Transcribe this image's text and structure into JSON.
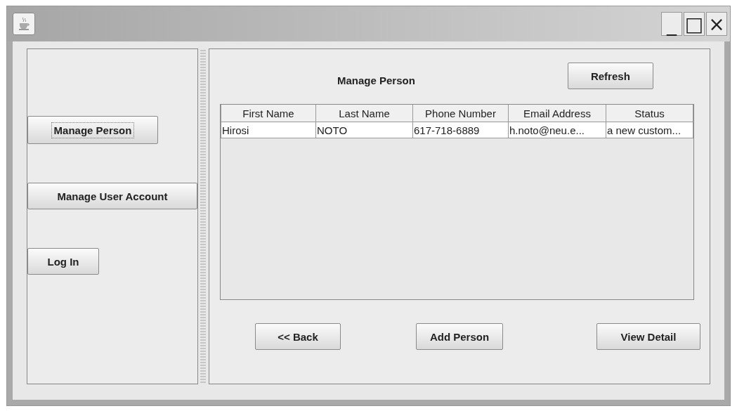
{
  "window": {
    "controls": [
      "_",
      "□",
      "×"
    ]
  },
  "sidebar": {
    "buttons": [
      {
        "label": "Manage Person",
        "focused": true
      },
      {
        "label": "Manage User Account",
        "focused": false
      },
      {
        "label": "Log In",
        "focused": false
      }
    ]
  },
  "main": {
    "title": "Manage Person",
    "refresh": "Refresh",
    "table": {
      "columns": [
        "First Name",
        "Last Name",
        "Phone Number",
        "Email Address",
        "Status"
      ],
      "rows": [
        [
          "Hirosi",
          "NOTO",
          "617-718-6889",
          "h.noto@neu.e...",
          "a new custom..."
        ]
      ]
    },
    "buttons": [
      "<< Back",
      "Add Person",
      "View Detail"
    ]
  }
}
